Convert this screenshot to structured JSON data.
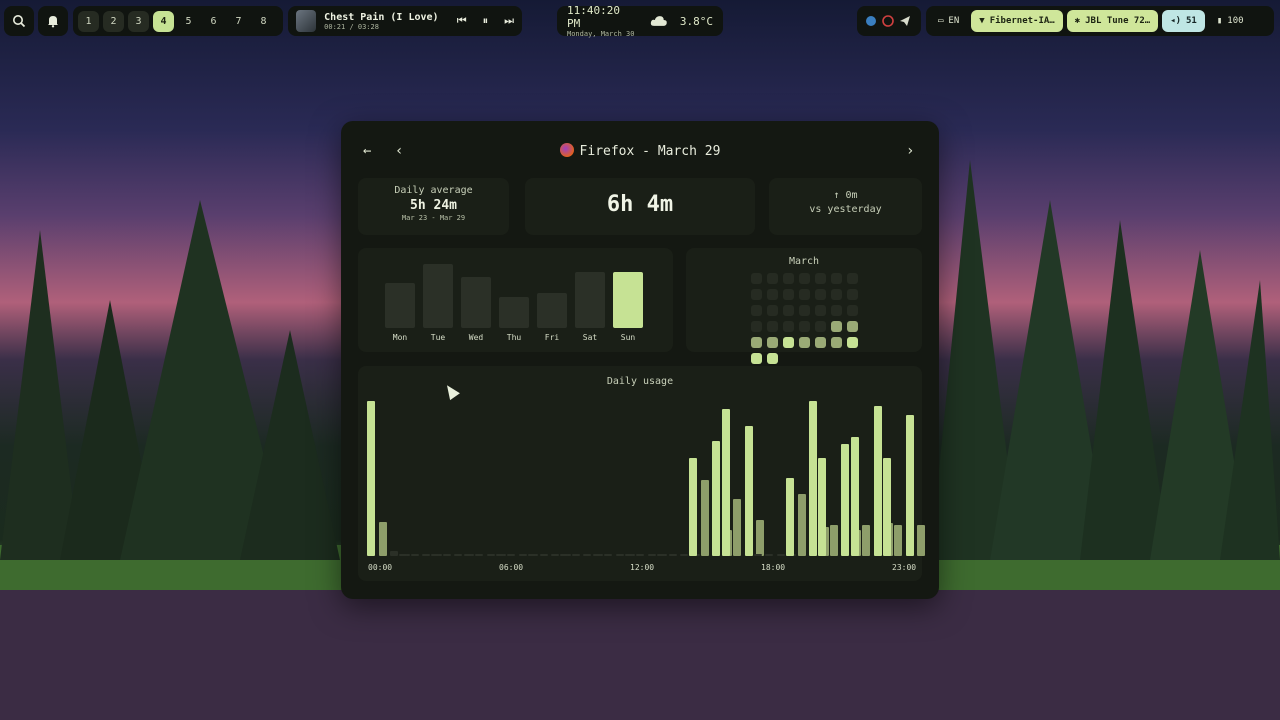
{
  "topbar": {
    "workspaces": [
      "1",
      "2",
      "3",
      "4",
      "5",
      "6",
      "7",
      "8"
    ],
    "active_workspace": "4",
    "occupied_workspaces": [
      "1",
      "2",
      "3"
    ],
    "media": {
      "title": "Chest Pain (I Love)",
      "time": "00:21 / 03:28"
    },
    "clock": {
      "time": "11:40:20 PM",
      "date": "Monday, March 30"
    },
    "weather": {
      "temp": "3.8°C"
    },
    "keyboard": "EN",
    "wifi": "Fibernet-IA…",
    "bluetooth": "JBL Tune 72…",
    "volume": "51",
    "battery": "100"
  },
  "window": {
    "title": "Firefox - March 29",
    "back_label": "←",
    "prev_label": "‹",
    "next_label": "›",
    "daily_average": {
      "label": "Daily average",
      "value": "5h 24m",
      "range": "Mar 23 - Mar 29"
    },
    "total": "6h 4m",
    "compare": {
      "value": "↑ 0m",
      "label": "vs yesterday"
    },
    "week": {
      "days": [
        "Mon",
        "Tue",
        "Wed",
        "Thu",
        "Fri",
        "Sat",
        "Sun"
      ],
      "values": [
        0.7,
        1.0,
        0.8,
        0.49,
        0.54,
        0.87,
        0.87
      ],
      "selected": "Sun"
    },
    "calendar": {
      "month": "March",
      "levels": [
        0,
        0,
        0,
        0,
        0,
        0,
        0,
        0,
        0,
        0,
        0,
        0,
        0,
        0,
        0,
        0,
        0,
        0,
        0,
        0,
        0,
        0,
        0,
        0,
        0,
        0,
        2,
        2,
        2,
        2,
        3,
        2,
        2,
        2,
        3,
        3,
        3,
        -1,
        -1,
        -1,
        -1,
        -1
      ]
    },
    "hourly": {
      "title": "Daily usage",
      "ticks": [
        "00:00",
        "06:00",
        "12:00",
        "18:00",
        "23:00"
      ],
      "slots": [
        [
          1.0,
          0.22,
          0.03,
          0.0
        ],
        [
          0,
          0,
          0,
          0
        ],
        [
          0,
          0,
          0,
          0
        ],
        [
          0,
          0,
          0,
          0
        ],
        [
          0,
          0,
          0,
          0
        ],
        [
          0,
          0,
          0,
          0
        ],
        [
          0,
          0,
          0,
          0
        ],
        [
          0,
          0,
          0,
          0
        ],
        [
          0,
          0,
          0,
          0
        ],
        [
          0,
          0,
          0,
          0
        ],
        [
          0.63,
          0.49,
          0.74,
          0.17
        ],
        [
          0.95,
          0.37,
          0.84,
          0.23
        ],
        [
          0,
          0,
          0,
          0
        ],
        [
          0.5,
          0.4,
          1.0,
          0.19
        ],
        [
          0.63,
          0.2,
          0.72,
          0.17
        ],
        [
          0.77,
          0.2,
          0.97,
          0.21
        ],
        [
          0.63,
          0.2,
          0.91,
          0.2
        ]
      ]
    }
  }
}
